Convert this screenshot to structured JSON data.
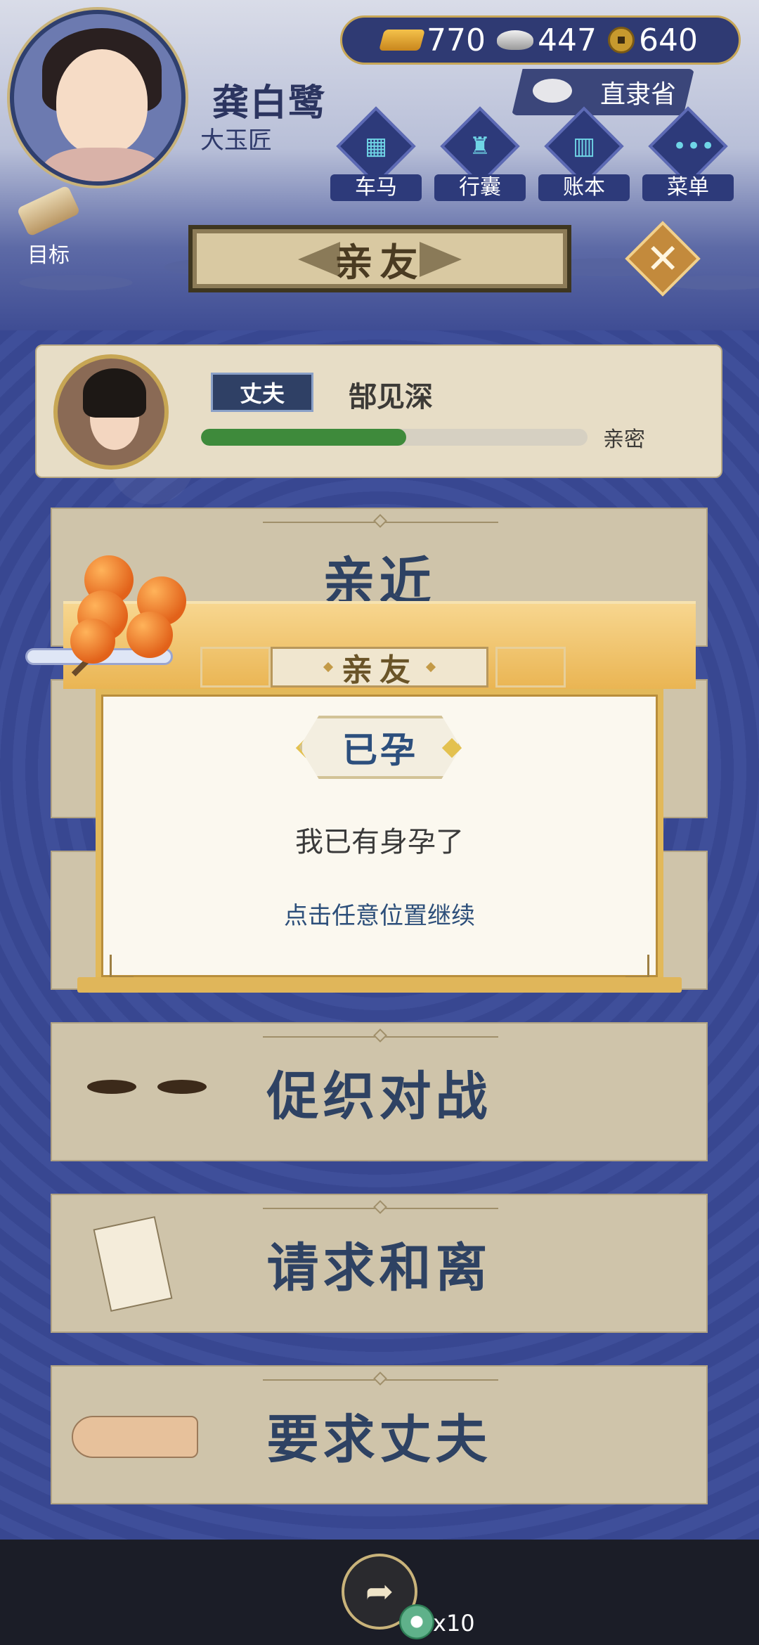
{
  "player": {
    "name": "龚白鹭",
    "title": "大玉匠"
  },
  "resources": {
    "gold": "770",
    "silver": "447",
    "coins": "640"
  },
  "region": "直隶省",
  "nav": {
    "carriage": "车马",
    "bag": "行囊",
    "ledger": "账本",
    "menu": "菜单",
    "goal": "目标"
  },
  "page_title": "亲友",
  "spouse": {
    "role": "丈夫",
    "name": "郜见深",
    "intimacy_label": "亲密",
    "intimacy_fraction": 0.53
  },
  "actions": [
    {
      "label": "亲近"
    },
    {
      "label": "促织对战"
    },
    {
      "label": "请求和离"
    },
    {
      "label": "要求丈夫"
    }
  ],
  "dialog": {
    "title": "亲友",
    "status": "已孕",
    "message": "我已有身孕了",
    "hint": "点击任意位置继续"
  },
  "bottom": {
    "reward_count": "x10"
  },
  "icons": {
    "gold": "gold-ingot-icon",
    "silver": "silver-ingot-icon",
    "coin": "copper-coin-icon",
    "share": "share-icon",
    "jade": "jade-disc-icon"
  }
}
